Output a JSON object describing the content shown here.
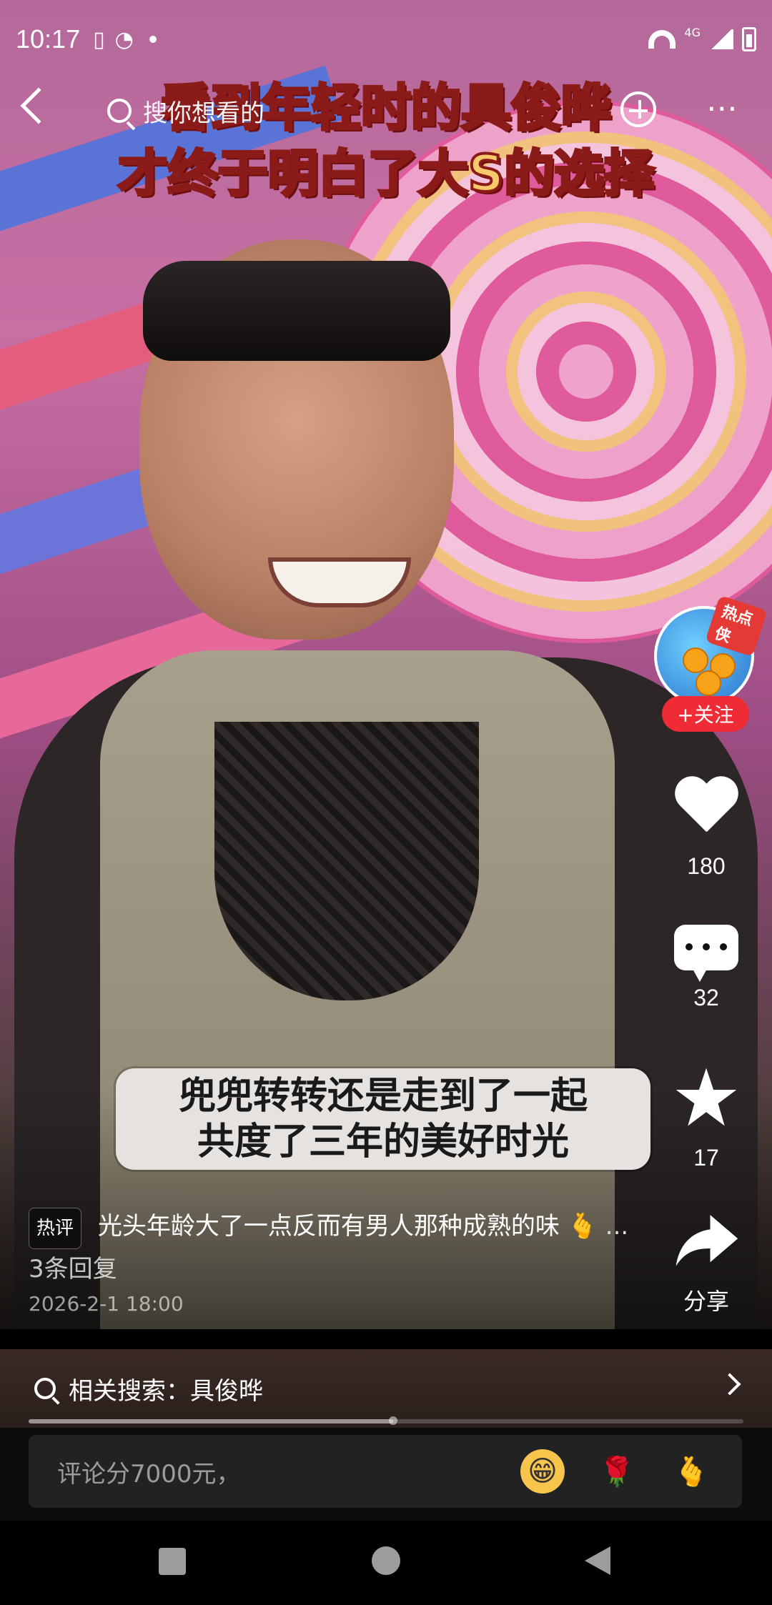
{
  "status_bar": {
    "time": "10:17",
    "network_type": "4G",
    "icons": [
      "vibrate-icon",
      "wechat-icon",
      "notification-dot",
      "wifi-icon",
      "signal-icon",
      "battery-icon"
    ]
  },
  "top_bar": {
    "search_placeholder": "搜你想看的",
    "icons": [
      "back-icon",
      "search-icon",
      "add-icon",
      "more-icon"
    ]
  },
  "video": {
    "caption_top_line1": "看到年轻时的具俊晔",
    "caption_top_line2": "才终于明白了大S的选择",
    "subtitle_line1": "兜兜转转还是走到了一起",
    "subtitle_line2": "共度了三年的美好时光"
  },
  "right_rail": {
    "avatar_badge": "热点侠",
    "follow_label": "+关注",
    "like_count": "180",
    "comment_count": "32",
    "favorite_count": "17",
    "share_label": "分享"
  },
  "hot_comment": {
    "badge": "热评",
    "text": "光头年龄大了一点反而有男人那种成熟的味",
    "ellipsis": "...",
    "replies": "3条回复",
    "date": "2026-2-1 18:00"
  },
  "related_search": {
    "label": "相关搜索：具俊晔"
  },
  "progress": {
    "fraction": 0.51
  },
  "comment_input": {
    "placeholder": "评论分7000元，",
    "emojis": [
      "grin-emoji",
      "flower-emoji",
      "heart-hand-emoji"
    ]
  },
  "colors": {
    "follow_red": "#ef2b35",
    "caption_yellow": "#f6c96a",
    "caption_outline": "#8a1b19"
  }
}
